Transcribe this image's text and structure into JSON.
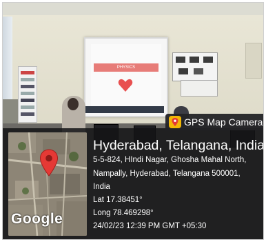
{
  "watermark": {
    "app_label": "GPS Map Camera",
    "place_title": "Hyderabad, Telangana, India",
    "address_lines": [
      "5-5-824, HIndi Nagar, Ghosha Mahal North,",
      "Nampally, Hyderabad, Telangana 500001,",
      "India"
    ],
    "latitude": "Lat 17.38451°",
    "longitude": "Long 78.469298°",
    "timestamp": "24/02/23 12:39 PM GMT +05:30",
    "map_brand": "Google"
  },
  "slide": {
    "title": "PHYSICS"
  },
  "colors": {
    "overlay": "#141416",
    "pin": "#e53935",
    "app_icon": "#f2b705"
  },
  "icons": {
    "map_pin": "location-pin-icon",
    "app": "gps-map-camera-icon"
  }
}
